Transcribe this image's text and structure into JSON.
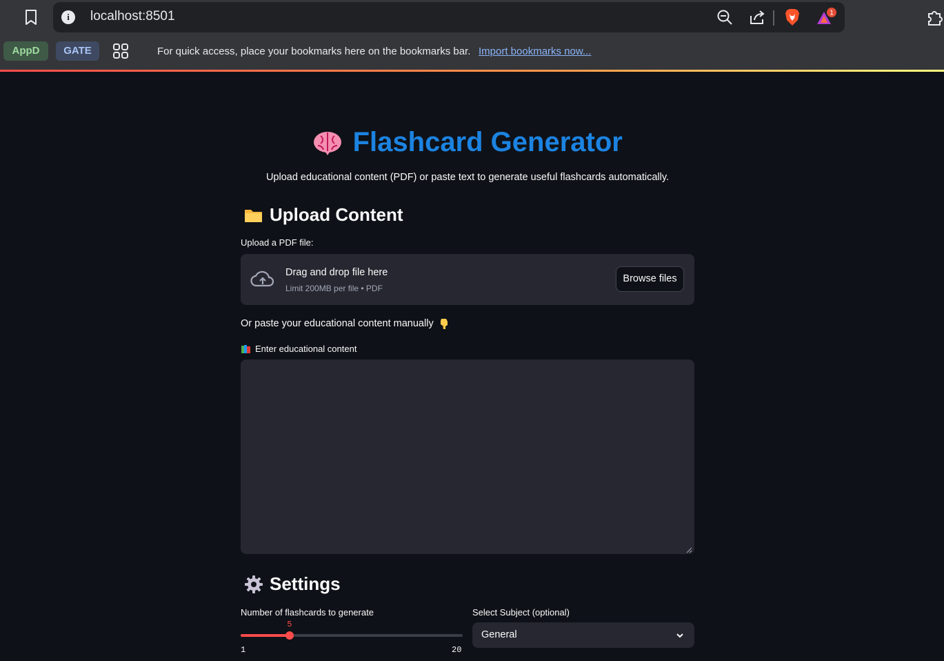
{
  "browser": {
    "url": "localhost:8501",
    "bookmarks": [
      {
        "label": "AppD",
        "color": "#9fdba0"
      },
      {
        "label": "GATE",
        "color": "#a9c4f5"
      }
    ],
    "bookmark_message": "For quick access, place your bookmarks here on the bookmarks bar.",
    "import_link": "Import bookmarks now...",
    "rewards_badge": "1"
  },
  "app": {
    "title": "Flashcard Generator",
    "title_emoji": "brain-icon",
    "subtitle": "Upload educational content (PDF) or paste text to generate useful flashcards automatically.",
    "accent_color": "#1c83e1",
    "upload_section": {
      "heading": "Upload Content",
      "heading_icon": "folder-icon",
      "label": "Upload a PDF file:",
      "dropzone_title": "Drag and drop file here",
      "dropzone_limit": "Limit 200MB per file • PDF",
      "browse_label": "Browse files"
    },
    "manual_section": {
      "prompt": "Or paste your educational content manually",
      "prompt_icon": "pointing-down-icon",
      "textarea_label": "Enter educational content",
      "textarea_icon": "books-icon",
      "textarea_value": ""
    },
    "settings": {
      "heading": "Settings",
      "heading_icon": "gear-icon",
      "slider_label": "Number of flashcards to generate",
      "slider_value": 5,
      "slider_min": 1,
      "slider_max": 20,
      "slider_value_text": "5",
      "slider_min_text": "1",
      "slider_max_text": "20",
      "slider_color": "#ff4b4b",
      "subject_label": "Select Subject (optional)",
      "subject_value": "General"
    }
  }
}
